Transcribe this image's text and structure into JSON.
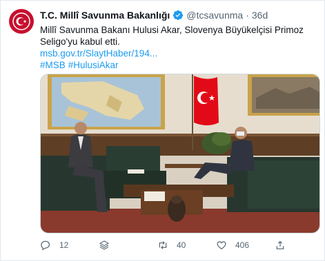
{
  "author": {
    "name": "T.C. Millî Savunma Bakanlığı",
    "handle": "@tcsavunma",
    "separator": "·",
    "time": "36d"
  },
  "tweet": {
    "text": "Millî Savunma Bakanı Hulusi Akar, Slovenya Büyükelçisi Primoz Seligo'yu kabul etti.",
    "link": "msb.gov.tr/SlaytHaber/194...",
    "hashtags": [
      "#MSB",
      "#HulusiAkar"
    ]
  },
  "actions": {
    "replies": "12",
    "retweets": "40",
    "likes": "406"
  },
  "icons": [
    "verified-badge-icon",
    "reply-icon",
    "share-stack-icon",
    "retweet-icon",
    "like-icon"
  ],
  "colors": {
    "accent": "#1d9bf0",
    "avatar": "#c8102e",
    "flag_red": "#e30a17",
    "muted": "#536471"
  }
}
